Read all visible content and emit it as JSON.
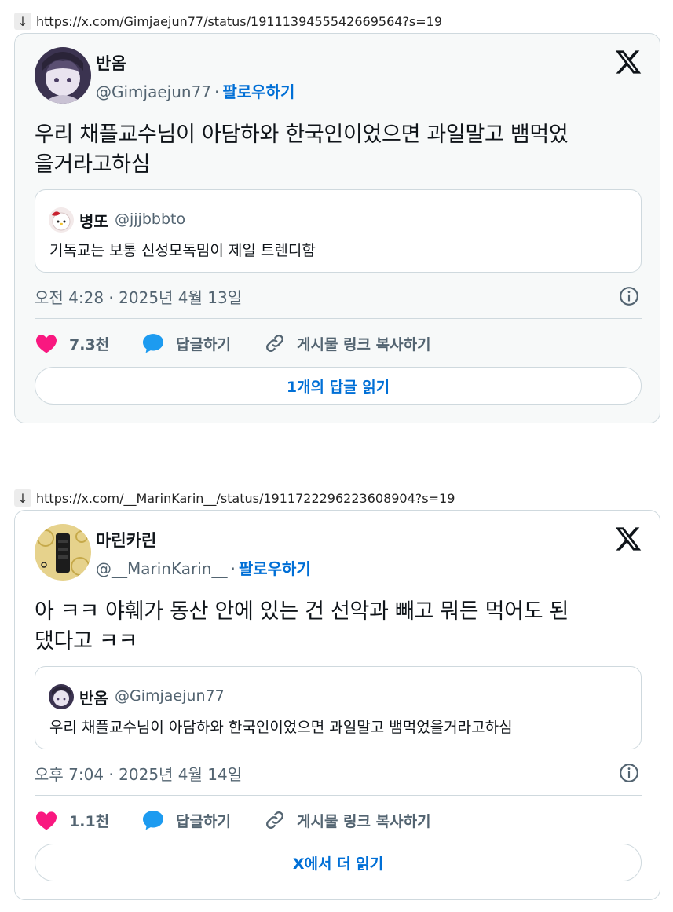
{
  "url_arrow": "↓",
  "posts": [
    {
      "url": "https://x.com/Gimjaejun77/status/1911139455542669564?s=19",
      "author_name": "반옴",
      "author_handle": "@Gimjaejun77",
      "separator": "·",
      "follow_label": "팔로우하기",
      "text_lines": [
        "우리 채플교수님이 아담하와 한국인이었으면 과일말고 뱀먹었",
        "을거라고하심"
      ],
      "quote": {
        "name": "병또",
        "handle": "@jjjbbbto",
        "text": "기독교는 보통 신성모독밈이 제일 트렌디함"
      },
      "timestamp": "오전 4:28 · 2025년 4월 13일",
      "likes": "7.3천",
      "reply_label": "답글하기",
      "copy_link_label": "게시물 링크 복사하기",
      "read_button": "1개의 답글 읽기"
    },
    {
      "url": "https://x.com/__MarinKarin__/status/1911722296223608904?s=19",
      "author_name": "마린카린",
      "author_handle": "@__MarinKarin__",
      "separator": "·",
      "follow_label": "팔로우하기",
      "text_lines": [
        "아 ㅋㅋ 야훼가 동산 안에 있는 건 선악과 빼고 뭐든 먹어도 된",
        "댔다고 ㅋㅋ"
      ],
      "quote": {
        "name": "반옴",
        "handle": "@Gimjaejun77",
        "text": "우리 채플교수님이 아담하와 한국인이었으면 과일말고 뱀먹었을거라고하심"
      },
      "timestamp": "오후 7:04 · 2025년 4월 14일",
      "likes": "1.1천",
      "reply_label": "답글하기",
      "copy_link_label": "게시물 링크 복사하기",
      "read_button": "X에서 더 읽기"
    }
  ],
  "colors": {
    "link_blue": "#006fd6",
    "like_pink": "#f91880",
    "reply_blue": "#1d9bf0",
    "muted": "#536471",
    "border": "#cfd9de"
  }
}
